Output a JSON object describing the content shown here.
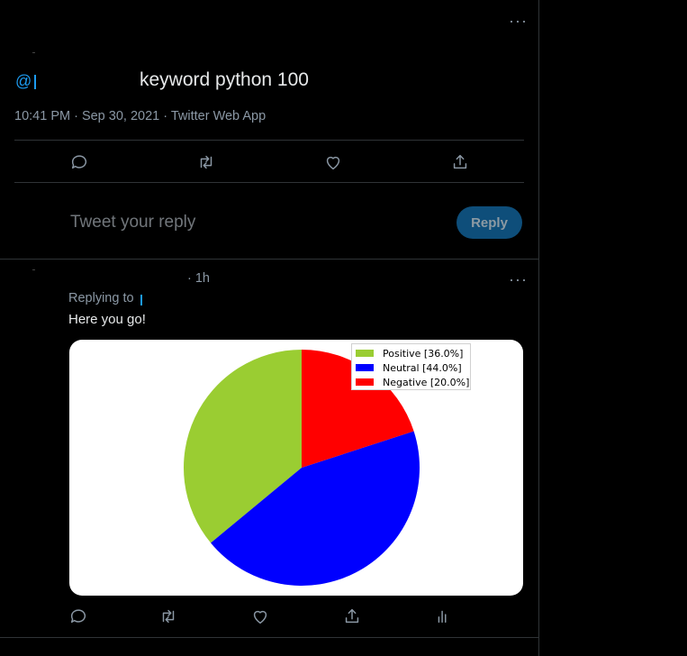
{
  "tweet": {
    "handle_prefix": "@",
    "text": "keyword python 100",
    "meta": "10:41 PM · Sep 30, 2021 · Twitter Web App",
    "more_label": "···"
  },
  "composer": {
    "placeholder": "Tweet your reply",
    "reply_button": "Reply"
  },
  "reply": {
    "time": "· 1h",
    "replying_to": "Replying to",
    "text": "Here you go!",
    "more_label": "···"
  },
  "icons": {
    "actions": [
      "comment-icon",
      "retweet-icon",
      "like-icon",
      "share-icon"
    ],
    "reply_actions": [
      "comment-icon",
      "retweet-icon",
      "like-icon",
      "share-icon",
      "analytics-icon"
    ]
  },
  "chart_data": {
    "type": "pie",
    "labels": [
      "Positive [36.0%]",
      "Neutral [44.0%]",
      "Negative [20.0%]"
    ],
    "values": [
      36.0,
      44.0,
      20.0
    ],
    "colors": [
      "#9acd32",
      "#0000ff",
      "#ff0000"
    ],
    "start_angle_deg": 90,
    "direction": "counterclockwise",
    "legend_position": "upper-right"
  }
}
